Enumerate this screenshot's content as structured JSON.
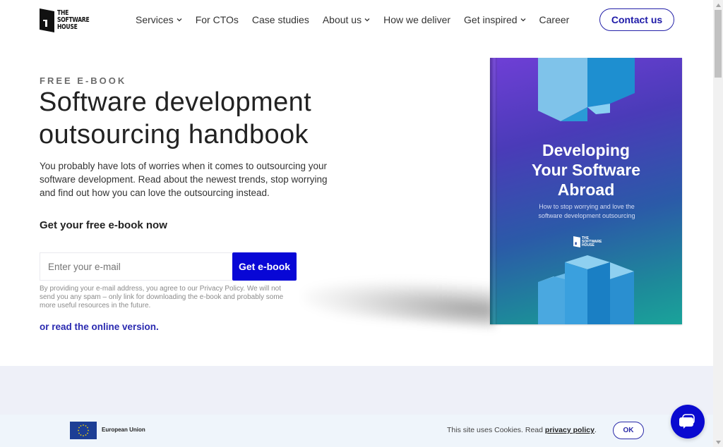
{
  "header": {
    "logo_lines": [
      "THE",
      "SOFTWARE",
      "HOUSE"
    ],
    "nav": [
      {
        "label": "Services",
        "dropdown": true
      },
      {
        "label": "For CTOs",
        "dropdown": false
      },
      {
        "label": "Case studies",
        "dropdown": false
      },
      {
        "label": "About us",
        "dropdown": true
      },
      {
        "label": "How we deliver",
        "dropdown": false
      },
      {
        "label": "Get inspired",
        "dropdown": true
      },
      {
        "label": "Career",
        "dropdown": false
      }
    ],
    "contact_label": "Contact us"
  },
  "hero": {
    "eyebrow": "FREE E-BOOK",
    "title_line1": "Software development",
    "title_line2": "outsourcing handbook",
    "description": "You probably have lots of worries when it comes to outsourcing your software development. Read about the newest trends, stop worrying and find out how you can love the outsourcing instead.",
    "cta_title": "Get your free e-book now",
    "email_placeholder": "Enter your e-mail",
    "email_value": "",
    "submit_label": "Get e-book",
    "disclaimer": "By providing your e-mail address, you agree to our Privacy Policy. We will not send you any spam – only link for downloading the e-book and probably some more useful resources in the future.",
    "online_link": "or read the online version."
  },
  "book": {
    "title_line1": "Developing",
    "title_line2": "Your Software",
    "title_line3": "Abroad",
    "subtitle": "How to stop worrying and love the software development outsourcing",
    "logo_lines": [
      "THE",
      "SOFTWARE",
      "HOUSE"
    ]
  },
  "footer": {
    "eu_label": "European Union",
    "cookie_text": "This site uses Cookies. Read ",
    "cookie_link": "privacy policy",
    "cookie_end": ".",
    "ok_label": "OK"
  },
  "colors": {
    "accent": "#0807d6",
    "link": "#2a2ab0",
    "band": "#eef0f8"
  }
}
